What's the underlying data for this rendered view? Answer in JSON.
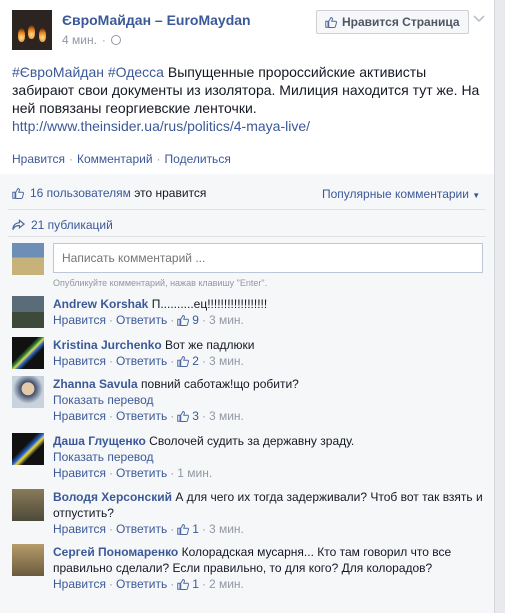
{
  "post": {
    "page_name": "ЄвроМайдан – EuroMaydan",
    "time": "4 мин.",
    "like_page_label": "Нравится Страница",
    "tags": "#ЄвроМайдан #Одесса",
    "text": "Выпущенные пророссийские активисты забирают свои документы из изолятора. Милиция находится тут же. На ней повязаны георгиевские ленточки.",
    "link": "http://www.theinsider.ua/rus/politics/4-maya-live/",
    "actions": {
      "like": "Нравится",
      "comment": "Комментарий",
      "share": "Поделиться"
    }
  },
  "ufi": {
    "likes_count": "16 пользователям",
    "likes_suffix": "это нравится",
    "sort_label": "Популярные комментарии",
    "shares": "21 публикаций",
    "comment_placeholder": "Написать комментарий ...",
    "comment_hint": "Опубликуйте комментарий, нажав клавишу \"Enter\"."
  },
  "labels": {
    "like": "Нравится",
    "reply": "Ответить",
    "translate": "Показать перевод"
  },
  "comments": [
    {
      "author": "Andrew Korshak",
      "text": "П..........ец!!!!!!!!!!!!!!!!!!",
      "likes": "9",
      "time": "3 мин."
    },
    {
      "author": "Kristina Jurchenko",
      "text": "Вот же падлюки",
      "likes": "2",
      "time": "3 мин."
    },
    {
      "author": "Zhanna Savula",
      "text": "повний саботаж!що робити?",
      "likes": "3",
      "time": "3 мин."
    },
    {
      "author": "Даша Глущенко",
      "text": "Сволочей судить за державну зраду.",
      "likes": "",
      "time": "1 мин."
    },
    {
      "author": "Володя Херсонский",
      "text": "А для чего их тогда задерживали? Чтоб вот так взять и отпустить?",
      "likes": "1",
      "time": "3 мин."
    },
    {
      "author": "Сергей Пономаренко",
      "text": "Колорадская мусарня... Кто там говорил что все правильно сделали? Если правильно, то для кого? Для колорадов?",
      "likes": "1",
      "time": "2 мин."
    }
  ],
  "colors": {
    "link": "#3b5998",
    "meta": "#9197a3",
    "background": "#e9eaed"
  }
}
